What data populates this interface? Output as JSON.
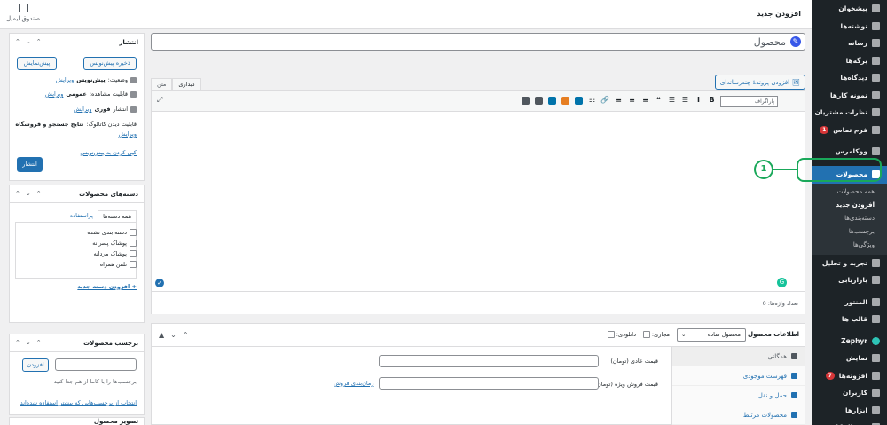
{
  "admin_menu": {
    "items": [
      {
        "label": "پیشخوان"
      },
      {
        "label": "نوشته‌ها"
      },
      {
        "label": "رسانه"
      },
      {
        "label": "برگه‌ها"
      },
      {
        "label": "دیدگاه‌ها"
      },
      {
        "label": "نمونه کارها"
      },
      {
        "label": "نظرات مشتریان"
      },
      {
        "label": "فرم تماس",
        "badge": "1"
      },
      {
        "label": "ووکامرس"
      },
      {
        "label": "محصولات"
      },
      {
        "label": "تجربه و تحلیل"
      },
      {
        "label": "بازاریابی"
      },
      {
        "label": "المنتور"
      },
      {
        "label": "قالب ها"
      },
      {
        "label": "Zephyr"
      },
      {
        "label": "نمایش"
      },
      {
        "label": "افزونه‌ها",
        "badge": "7"
      },
      {
        "label": "کاربران"
      },
      {
        "label": "ابزارها"
      },
      {
        "label": "ویژوال کامپوزر"
      }
    ],
    "products_submenu": [
      "همه محصولات",
      "افزودن جدید",
      "دسته‌بندی‌ها",
      "برچسب‌ها",
      "ویژگی‌ها"
    ]
  },
  "header": {
    "title": "افزودن جدید",
    "inbox_label": "صندوق ایمیل"
  },
  "editor": {
    "title_placeholder": "محصول",
    "add_media": "افزودن پروندهٔ چندرسانه‌ای",
    "tabs": [
      "دیداری",
      "متن"
    ],
    "format_select": "پاراگراف",
    "toolbar_tools": [
      "B",
      "I",
      "☰",
      "☰",
      "❝",
      "≡",
      "≡",
      "≡",
      "🔗",
      "⚏"
    ],
    "word_count": "تعداد واژه‌ها: 0"
  },
  "callout": {
    "number": "1"
  },
  "product_data": {
    "title": "اطلاعات محصول —",
    "type_value": "محصول ساده",
    "virtual_label": "مجازی:",
    "downloadable_label": "دانلودی:",
    "tabs": [
      "همگانی",
      "فهرست موجودی",
      "حمل و نقل",
      "محصولات مرتبط",
      "ویژگی‌ها"
    ],
    "regular_price_label": "قیمت عادی (تومان)",
    "sale_price_label": "قیمت فروش ویژه (تومان)",
    "schedule_link": "زمان‌بندی فروش"
  },
  "publish": {
    "title": "انتشار",
    "save_draft": "ذخیره پیش‌نویس",
    "preview": "پیش‌نمایش",
    "status_label": "وضعیت:",
    "status_value": "پیش‌نویس",
    "visibility_label": "قابلیت مشاهده:",
    "visibility_value": "عمومی",
    "publish_label": "انتشار",
    "publish_value": "فوری",
    "catalog_label": "قابلیت دیدن کاتالوگ:",
    "catalog_value": "نتایج جستجو و فروشگاه",
    "edit_link": "ویرایش",
    "copy_link": "کپی کردن به پیش‌نویس",
    "publish_button": "انتشار"
  },
  "categories": {
    "title": "دسته‌های محصولات",
    "tab_all": "همه دسته‌ها",
    "tab_popular": "پراستفاده",
    "items": [
      "دسته بندی نشده",
      "پوشاک پسرانه",
      "پوشاک مردانه",
      "تلفن همراه"
    ],
    "add_new": "+ افزودن دسته جدید"
  },
  "tags": {
    "title": "برچسب محصولات",
    "add_button": "افزودن",
    "hint": "برچسب‌ها را با کاما از هم جدا کنید",
    "choose_link": "انتخاب از برچسب‌هایی که بیشتر استفاده شده‌اند"
  },
  "image": {
    "title": "تصویر محصول"
  },
  "colors": {
    "accent": "#2271b1",
    "callout": "#1aa85a",
    "menu_bg": "#1d2327"
  }
}
